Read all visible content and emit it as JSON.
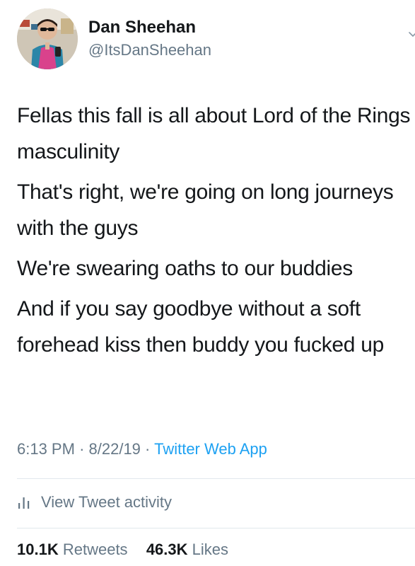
{
  "author": {
    "name": "Dan Sheehan",
    "handle": "@ItsDanSheehan"
  },
  "tweet": {
    "paragraphs": [
      "Fellas this fall is all about Lord of the Rings masculinity",
      "That's right, we're going on long journeys with the guys",
      "We're swearing oaths to our buddies",
      "And if you say goodbye without a soft forehead kiss then buddy you fucked up"
    ],
    "time": "6:13 PM",
    "date": "8/22/19",
    "separator": "·",
    "source": "Twitter Web App"
  },
  "activity": {
    "label": "View Tweet activity",
    "icon": "bar-chart-icon"
  },
  "stats": {
    "retweets_count": "10.1K",
    "retweets_label": "Retweets",
    "likes_count": "46.3K",
    "likes_label": "Likes"
  },
  "colors": {
    "text": "#14171a",
    "secondary": "#657786",
    "link": "#1da1f2",
    "divider": "#e1e8ed"
  }
}
